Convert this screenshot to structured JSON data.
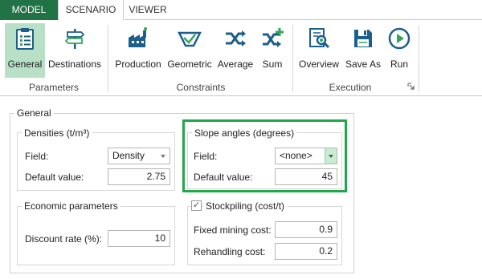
{
  "tabs": {
    "model": "MODEL",
    "scenario": "SCENARIO",
    "viewer": "VIEWER"
  },
  "ribbon": {
    "groups": {
      "parameters": "Parameters",
      "constraints": "Constraints",
      "execution": "Execution"
    },
    "buttons": {
      "general": "General",
      "destinations": "Destinations",
      "production": "Production",
      "geometric": "Geometric",
      "average": "Average",
      "sum": "Sum",
      "overview": "Overview",
      "save_as": "Save As",
      "run": "Run"
    }
  },
  "general": {
    "title": "General",
    "densities": {
      "title": "Densities (t/m³)",
      "field_label": "Field:",
      "field_value": "Density",
      "default_label": "Default value:",
      "default_value": "2.75"
    },
    "slope": {
      "title": "Slope angles (degrees)",
      "field_label": "Field:",
      "field_value": "<none>",
      "default_label": "Default value:",
      "default_value": "45"
    },
    "economic": {
      "title": "Economic parameters",
      "discount_label": "Discount rate (%):",
      "discount_value": "10"
    },
    "stockpiling": {
      "title": "Stockpiling (cost/t)",
      "check_mark": "✓",
      "fixed_label": "Fixed mining cost:",
      "fixed_value": "0.9",
      "rehandling_label": "Rehandling cost:",
      "rehandling_value": "0.2"
    }
  },
  "colors": {
    "accent_green": "#217346",
    "active_button": "#b7e0c6",
    "highlight_border": "#1fa84a",
    "icon_blue": "#1d5f8c",
    "icon_green": "#33a558"
  }
}
